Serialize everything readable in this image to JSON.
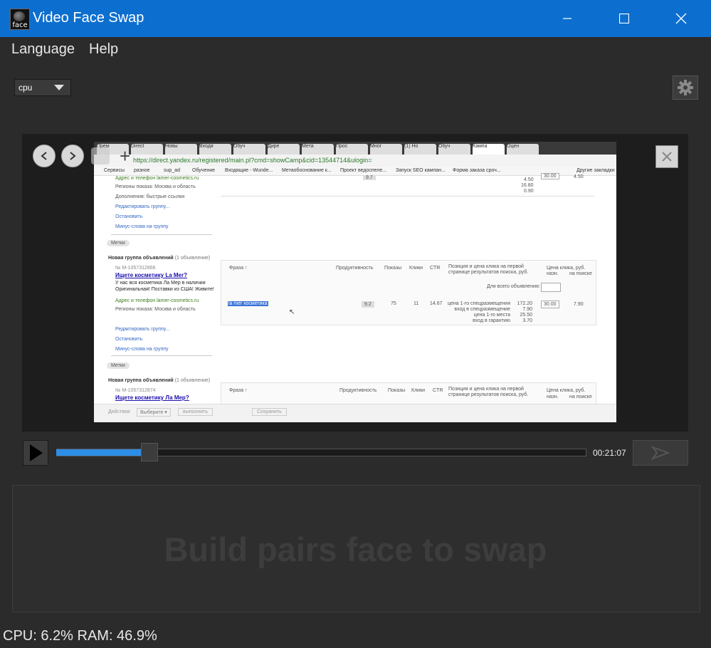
{
  "window": {
    "title": "Video Face Swap",
    "icon_label": "face",
    "controls": {
      "minimize": "—",
      "maximize": "☐",
      "close": "✕"
    }
  },
  "menu": {
    "items": [
      "Language",
      "Help"
    ]
  },
  "toolbar": {
    "device_value": "cpu",
    "settings_icon": "gear-icon"
  },
  "player": {
    "time": "00:21:07",
    "progress": 0.16
  },
  "pairs_panel": {
    "placeholder": "Build pairs face to swap"
  },
  "status_bar": {
    "cpu": "CPU: 6.2%",
    "ram": "RAM: 46.9%"
  },
  "video_frame": {
    "tabs": [
      "Прем",
      "Direct",
      "Новы",
      "Входя",
      "Обуч",
      "Дире",
      "Мета",
      "Прос",
      "Мног",
      "(1) Но",
      "Обуч",
      "Кампа",
      "Оцен"
    ],
    "url": "https://direct.yandex.ru/registered/main.pl?cmd=showCamp&cid=13544714&ulogin=",
    "bookmarks": [
      "Сервисы",
      "разное",
      "sup_ad",
      "Обучение",
      "Входящие - Wunde...",
      "Метаобоснование к...",
      "Проект ведоспеле...",
      "Запуск SEO кампан...",
      "Форма заказа сроч...",
      "Другие закладки"
    ],
    "group1": {
      "contact_link": "Адрес и телефон",
      "contact_domain": "lamer-cosmetics.ru",
      "regions": "Регионы показа: Москва и область",
      "extras": "Дополнения: быстрые ссылки",
      "edit_group": "Редактировать группу...",
      "stop": "Остановить",
      "minus_words": "Минус-слова на группу",
      "labels": "Метки",
      "row_values": [
        "9.7",
        "4.50",
        "16.80",
        "0.90",
        "30.00",
        "4.50"
      ]
    },
    "group2": {
      "title": "Новая группа объявлений",
      "count": "(1 объявление)",
      "number": "№ M-1057312866",
      "ad_title": "Ищете косметику La Mer?",
      "ad_text": "У нас вся косметика Ла Мер в наличии Оригинальная! Поставки из США! Живите!",
      "contact_link": "Адрес и телефон",
      "contact_domain": "lamer-cosmetics.ru",
      "regions": "Регионы показа: Москва и область",
      "edit_group": "Редактировать группу...",
      "stop": "Остановить",
      "minus_words": "Минус-слова на группу",
      "labels": "Метки",
      "headers": [
        "Фраза ↑",
        "Продуктивность",
        "Показы",
        "Клики",
        "CTR",
        "Позиция и цена клика на первой странице результатов поиска, руб.",
        "Цена клика, руб.",
        "назн.",
        "на поиске"
      ],
      "for_all": "Для всего объявления:",
      "phrase": "la mer косметика",
      "productivity": "9.2",
      "shows": "75",
      "clicks": "11",
      "ctr": "14.67",
      "positions": [
        "цена 1-го спецразмещения",
        "вход в спецразмещение",
        "цена 1-го места",
        "вход в гарантию"
      ],
      "prices": [
        "172.20",
        "7.90",
        "25.50",
        "3.70"
      ],
      "bid": "30.00",
      "search_price": "7.90"
    },
    "group3": {
      "title": "Новая группа объявлений",
      "count": "(1 объявление)",
      "number": "№ M-1057312874",
      "ad_title": "Ищете косметику Ла Мер?",
      "headers": [
        "Фраза ↑",
        "Продуктивность",
        "Показы",
        "Клики",
        "CTR",
        "Позиция и цена клика на первой странице результатов поиска, руб.",
        "Цена клика, руб.",
        "назн.",
        "на поиске"
      ]
    },
    "footer": {
      "actions": "Действия",
      "choose": "Выберите ▾",
      "execute": "выполнить",
      "save": "Сохранить"
    }
  }
}
